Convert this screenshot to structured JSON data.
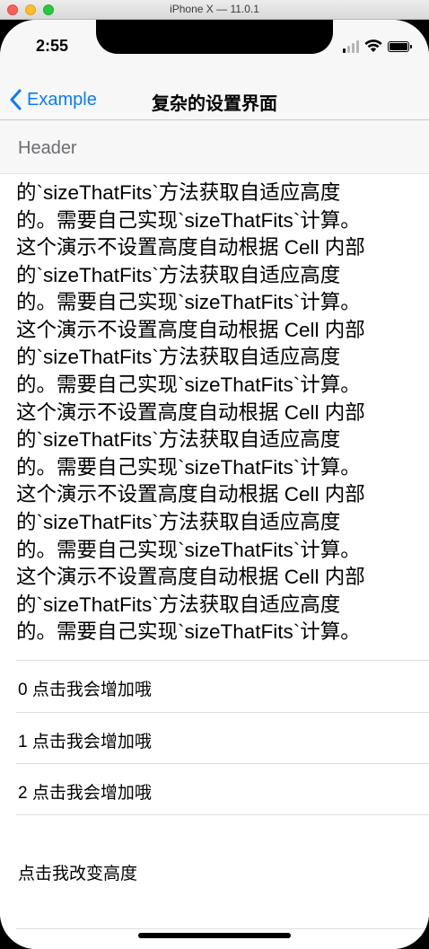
{
  "window": {
    "title": "iPhone X — 11.0.1"
  },
  "status_bar": {
    "time": "2:55",
    "signal_bars_active": 1,
    "signal_bars_total": 4,
    "battery_level": 1.0
  },
  "nav_bar": {
    "back_label": "Example",
    "title": "复杂的设置界面"
  },
  "section": {
    "header": "Header"
  },
  "long_text": {
    "lines": [
      "的`sizeThatFits`方法获取自适应高度",
      "的。需要自己实现`sizeThatFits`计算。",
      "这个演示不设置高度自动根据 Cell 内部",
      "的`sizeThatFits`方法获取自适应高度",
      "的。需要自己实现`sizeThatFits`计算。",
      "这个演示不设置高度自动根据 Cell 内部",
      "的`sizeThatFits`方法获取自适应高度",
      "的。需要自己实现`sizeThatFits`计算。",
      "这个演示不设置高度自动根据 Cell 内部",
      "的`sizeThatFits`方法获取自适应高度",
      "的。需要自己实现`sizeThatFits`计算。",
      "这个演示不设置高度自动根据 Cell 内部",
      "的`sizeThatFits`方法获取自适应高度",
      "的。需要自己实现`sizeThatFits`计算。",
      "这个演示不设置高度自动根据 Cell 内部",
      "的`sizeThatFits`方法获取自适应高度",
      "的。需要自己实现`sizeThatFits`计算。"
    ]
  },
  "rows": [
    {
      "label": "0 点击我会增加哦"
    },
    {
      "label": "1 点击我会增加哦"
    },
    {
      "label": "2 点击我会增加哦"
    }
  ],
  "height_cell": {
    "label": "点击我改变高度"
  },
  "colors": {
    "accent": "#0a7aff",
    "header_text": "#6d6d72",
    "separator": "#dedede"
  }
}
